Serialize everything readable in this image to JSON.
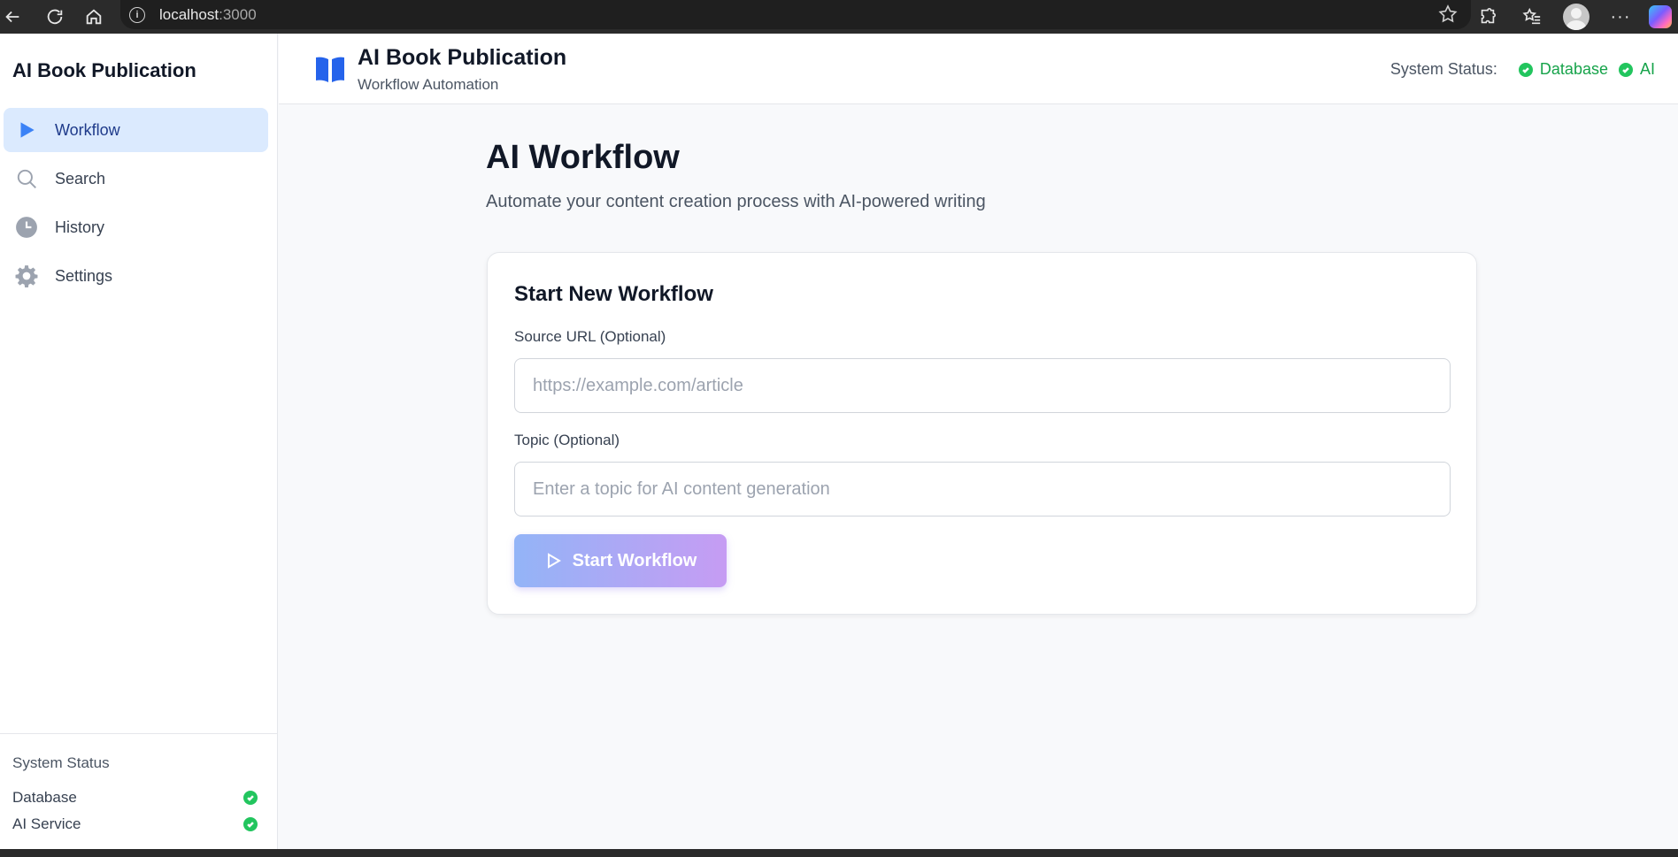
{
  "browser": {
    "url_host": "localhost",
    "url_port": ":3000"
  },
  "sidebar": {
    "title": "AI Book Publication",
    "items": [
      {
        "label": "Workflow",
        "icon": "play-icon",
        "active": true
      },
      {
        "label": "Search",
        "icon": "search-icon",
        "active": false
      },
      {
        "label": "History",
        "icon": "clock-icon",
        "active": false
      },
      {
        "label": "Settings",
        "icon": "gear-icon",
        "active": false
      }
    ],
    "footer": {
      "title": "System Status",
      "rows": [
        {
          "label": "Database",
          "status": "ok"
        },
        {
          "label": "AI Service",
          "status": "ok"
        }
      ]
    }
  },
  "header": {
    "title": "AI Book Publication",
    "subtitle": "Workflow Automation",
    "status_label": "System Status:",
    "status_items": [
      {
        "label": "Database",
        "status": "ok"
      },
      {
        "label": "AI",
        "status": "ok"
      }
    ]
  },
  "main": {
    "title": "AI Workflow",
    "subtitle": "Automate your content creation process with AI-powered writing",
    "card": {
      "title": "Start New Workflow",
      "source_label": "Source URL (Optional)",
      "source_value": "",
      "source_placeholder": "https://example.com/article",
      "topic_label": "Topic (Optional)",
      "topic_value": "",
      "topic_placeholder": "Enter a topic for AI content generation",
      "start_label": "Start Workflow"
    }
  },
  "colors": {
    "accent": "#2563eb",
    "active_bg": "#dbeafe",
    "status_ok": "#22c55e",
    "button_gradient_start": "#93b4f7",
    "button_gradient_end": "#c69cf3"
  }
}
